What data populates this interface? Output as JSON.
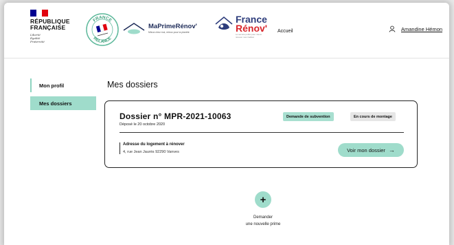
{
  "header": {
    "republique_line1": "RÉPUBLIQUE",
    "republique_line2": "FRANÇAISE",
    "devise_liberte": "Liberté",
    "devise_egalite": "Égalité",
    "devise_fraternite": "Fraternité",
    "relance_top": "FRANCE",
    "relance_bottom": "RELANCE",
    "mpr_title": "MaPrimeRénov'",
    "mpr_tagline": "Mieux chez moi, mieux pour la planète",
    "fr_line1": "France",
    "fr_line2": "Rénov'",
    "fr_tagline": "Le service public pour mieux rénover mon habitat",
    "nav_accueil": "Accueil",
    "user_name": "Amandine Hémon"
  },
  "sidebar": {
    "items": [
      {
        "label": "Mon profil"
      },
      {
        "label": "Mes dossiers"
      }
    ]
  },
  "main": {
    "title": "Mes dossiers",
    "dossier": {
      "title": "Dossier n° MPR-2021-10063",
      "depose": "Déposé le 20 octobre 2020",
      "badge_type": "Demande de subvention",
      "badge_status": "En cours de montage",
      "address_label": "Adresse du logement à rénover",
      "address_value": "4, rue Jean Jaurès 92290 Vanves",
      "voir_label": "Voir mon dossier"
    },
    "new_request_line1": "Demander",
    "new_request_line2": "une nouvelle prime"
  },
  "colors": {
    "accent_green": "#9fdccb",
    "flag_blue": "#000091",
    "flag_red": "#e1000f",
    "brand_navy": "#2e3d7c",
    "brand_red": "#d8262c"
  },
  "icons": {
    "user": "user-icon",
    "arrow": "arrow-right-icon",
    "plus": "plus-icon"
  }
}
